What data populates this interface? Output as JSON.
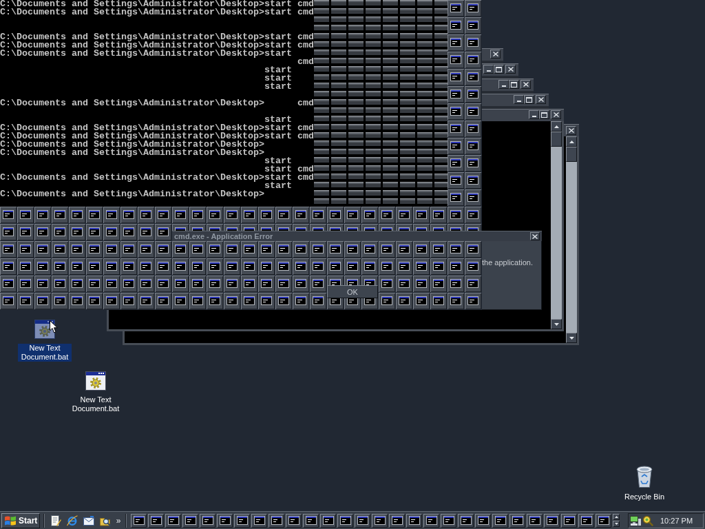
{
  "console": {
    "lines": [
      {
        "kind": "text",
        "prompt": "C:\\Documents and Settings\\Administrator\\Desktop>",
        "command": "start",
        "argument": "cmd"
      },
      {
        "kind": "text",
        "prompt": "C:\\Documents and Settings\\Administrator\\Desktop>",
        "command": "start",
        "argument": "cmd"
      },
      {
        "kind": "blank"
      },
      {
        "kind": "blank"
      },
      {
        "kind": "text",
        "prompt": "C:\\Documents and Settings\\Administrator\\Desktop>",
        "command": "start",
        "argument": "cmd"
      },
      {
        "kind": "text",
        "prompt": "C:\\Documents and Settings\\Administrator\\Desktop>",
        "command": "start",
        "argument": "cmd"
      },
      {
        "kind": "text",
        "prompt": "C:\\Documents and Settings\\Administrator\\Desktop>",
        "command": "start"
      },
      {
        "kind": "text",
        "argument": "cmd"
      },
      {
        "kind": "text",
        "command": "start"
      },
      {
        "kind": "text",
        "command": "start"
      },
      {
        "kind": "text",
        "command": "start"
      },
      {
        "kind": "blank"
      },
      {
        "kind": "text",
        "prompt": "C:\\Documents and Settings\\Administrator\\Desktop>",
        "argument": "cmd"
      },
      {
        "kind": "blank"
      },
      {
        "kind": "text",
        "command": "start"
      },
      {
        "kind": "text",
        "prompt": "C:\\Documents and Settings\\Administrator\\Desktop>",
        "command": "start",
        "argument": "cmd"
      },
      {
        "kind": "text",
        "prompt": "C:\\Documents and Settings\\Administrator\\Desktop>",
        "command": "start",
        "argument": "cmd"
      },
      {
        "kind": "text",
        "prompt": "C:\\Documents and Settings\\Administrator\\Desktop>"
      },
      {
        "kind": "text",
        "prompt": "C:\\Documents and Settings\\Administrator\\Desktop>"
      },
      {
        "kind": "text",
        "command": "start"
      },
      {
        "kind": "text",
        "command": "start",
        "argument": "cmd"
      },
      {
        "kind": "text",
        "prompt": "C:\\Documents and Settings\\Administrator\\Desktop>",
        "command": "start",
        "argument": "cmd"
      },
      {
        "kind": "text",
        "command": "start"
      },
      {
        "kind": "text",
        "prompt": "C:\\Documents and Settings\\Administrator\\Desktop>"
      }
    ]
  },
  "dialog": {
    "title": "cmd.exe - Application Error",
    "message": "the application.",
    "button": "OK"
  },
  "desktop_icons": [
    {
      "kind": "batch_file",
      "label": "New Text Document.bat",
      "selected": true
    },
    {
      "kind": "batch_file",
      "label": "New Text Document.bat",
      "selected": false
    },
    {
      "kind": "recycle_bin",
      "label": "Recycle Bin",
      "selected": false
    }
  ],
  "taskbar": {
    "start_button": "Start",
    "more_button": "»",
    "clock": "10:27 PM"
  }
}
